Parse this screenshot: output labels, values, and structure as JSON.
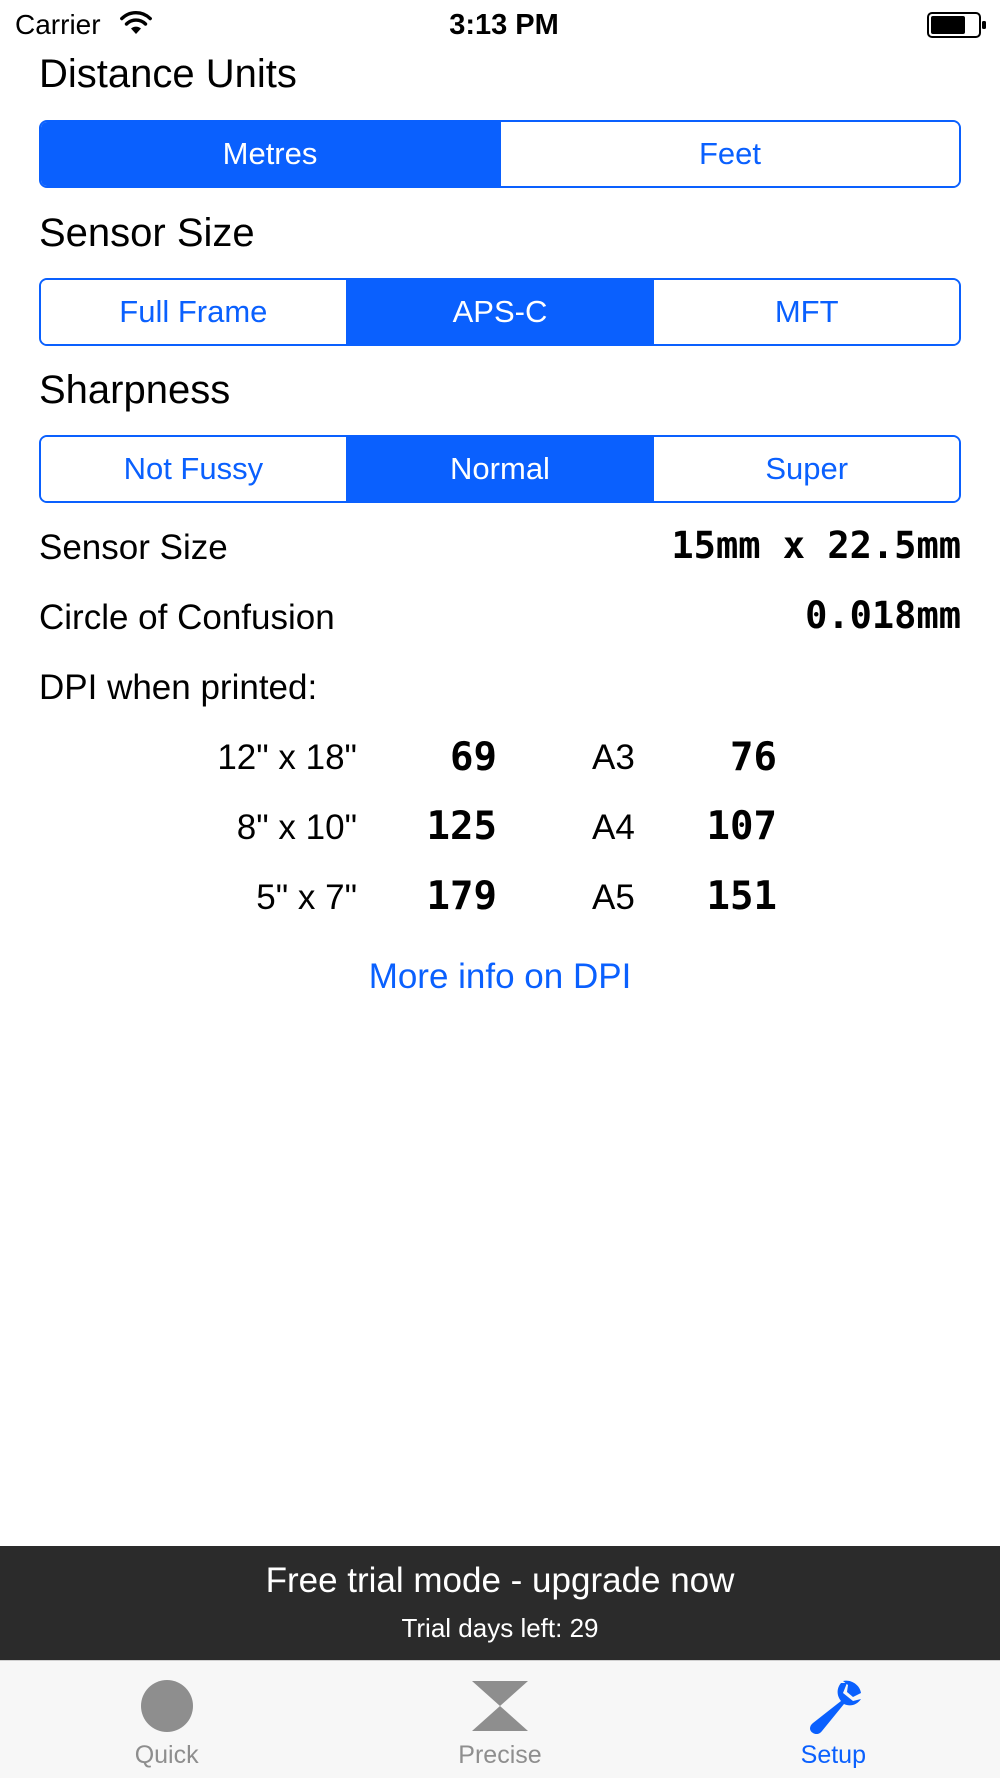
{
  "status_bar": {
    "carrier": "Carrier",
    "time": "3:13 PM",
    "wifi_icon": "wifi-icon",
    "battery_icon": "battery-icon"
  },
  "distance_units": {
    "title": "Distance Units",
    "options": [
      "Metres",
      "Feet"
    ],
    "selected": "Metres"
  },
  "sensor_size_picker": {
    "title": "Sensor Size",
    "options": [
      "Full Frame",
      "APS-C",
      "MFT"
    ],
    "selected": "APS-C"
  },
  "sharpness": {
    "title": "Sharpness",
    "options": [
      "Not Fussy",
      "Normal",
      "Super"
    ],
    "selected": "Normal"
  },
  "info": {
    "sensor_size_label": "Sensor Size",
    "sensor_size_value": "15mm x 22.5mm",
    "coc_label": "Circle of Confusion",
    "coc_value": "0.018mm",
    "dpi_label": "DPI when printed:"
  },
  "dpi_table": [
    {
      "size": "12\" x 18\"",
      "dpi": "69",
      "paper": "A3",
      "paper_dpi": "76"
    },
    {
      "size": "8\" x 10\"",
      "dpi": "125",
      "paper": "A4",
      "paper_dpi": "107"
    },
    {
      "size": "5\" x 7\"",
      "dpi": "179",
      "paper": "A5",
      "paper_dpi": "151"
    }
  ],
  "more_info_link": "More info on DPI",
  "trial_banner": {
    "title": "Free trial mode - upgrade now",
    "subtitle": "Trial days left: 29"
  },
  "tab_bar": {
    "tabs": [
      {
        "label": "Quick",
        "icon": "circle-icon"
      },
      {
        "label": "Precise",
        "icon": "hourglass-icon"
      },
      {
        "label": "Setup",
        "icon": "wrench-icon"
      }
    ],
    "active": "Setup"
  },
  "colors": {
    "accent": "#0a60fe",
    "banner_bg": "#2b2b2b",
    "tab_bar_bg": "#f7f7f7",
    "inactive_tab": "#8e8e8e"
  }
}
